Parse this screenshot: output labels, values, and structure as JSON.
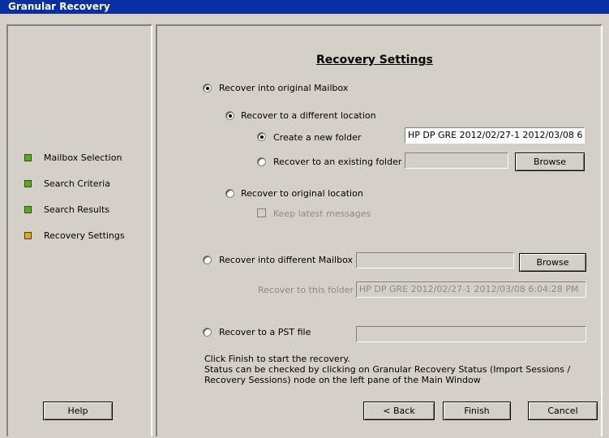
{
  "window": {
    "title": "Granular Recovery"
  },
  "steps": [
    {
      "label": "Mailbox Selection",
      "color": "#55b000"
    },
    {
      "label": "Search Criteria",
      "color": "#55b000"
    },
    {
      "label": "Search Results",
      "color": "#55b000"
    },
    {
      "label": "Recovery Settings",
      "color": "#e0a800"
    }
  ],
  "main": {
    "heading": "Recovery Settings",
    "opt_original_mailbox": "Recover into original Mailbox",
    "opt_different_location": "Recover to a different location",
    "opt_new_folder": "Create a new folder",
    "new_folder_value": "HP DP GRE 2012/02/27-1 2012/03/08 6",
    "opt_existing_folder": "Recover to an existing folder",
    "existing_folder_value": "",
    "opt_original_location": "Recover to original location",
    "keep_latest": "Keep latest messages",
    "opt_different_mailbox": "Recover into different Mailbox",
    "different_mailbox_value": "",
    "recover_to_folder_label": "Recover to this folder",
    "recover_to_folder_value": "HP DP GRE 2012/02/27-1 2012/03/08 6:04:28 PM",
    "opt_pst": "Recover to a PST file",
    "pst_value": "",
    "info_line1": "Click Finish to start the recovery.",
    "info_line2": "Status can be checked by clicking on Granular Recovery Status (Import Sessions /",
    "info_line3": "Recovery Sessions) node on the left pane of the Main Window"
  },
  "buttons": {
    "browse1": "Browse",
    "browse2": "Browse",
    "help": "Help",
    "back": "< Back",
    "finish": "Finish",
    "cancel": "Cancel"
  }
}
